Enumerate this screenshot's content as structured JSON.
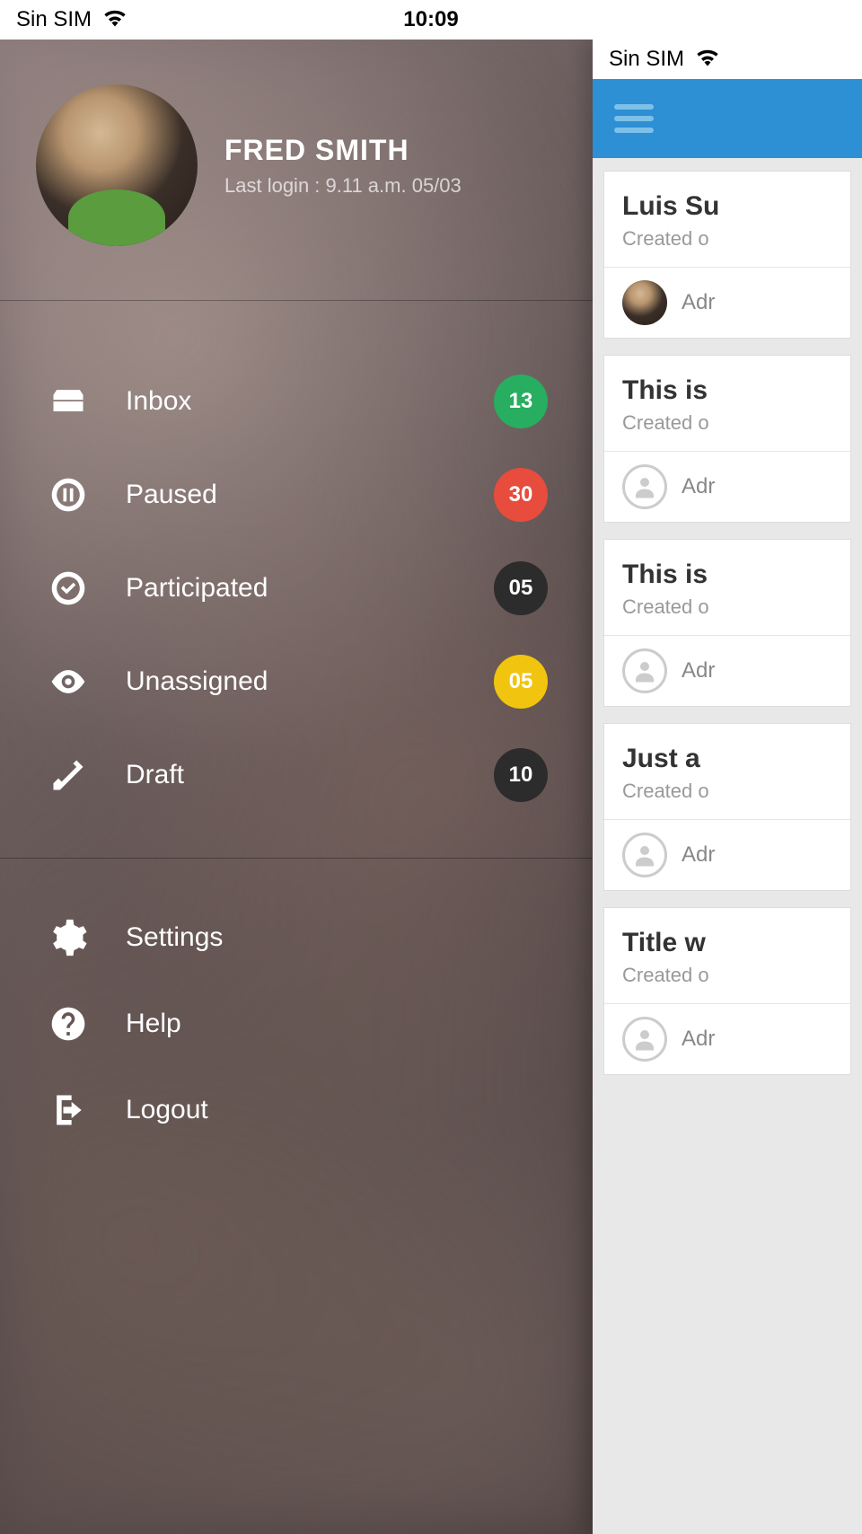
{
  "status_bar": {
    "carrier": "Sin SIM",
    "time": "10:09"
  },
  "profile": {
    "name": "FRED SMITH",
    "last_login": "Last login : 9.11 a.m. 05/03"
  },
  "menu": {
    "items": [
      {
        "label": "Inbox",
        "count": "13",
        "badge_class": "badge-green",
        "icon": "inbox"
      },
      {
        "label": "Paused",
        "count": "30",
        "badge_class": "badge-red",
        "icon": "pause"
      },
      {
        "label": "Participated",
        "count": "05",
        "badge_class": "badge-dark",
        "icon": "check"
      },
      {
        "label": "Unassigned",
        "count": "05",
        "badge_class": "badge-yellow",
        "icon": "eye"
      },
      {
        "label": "Draft",
        "count": "10",
        "badge_class": "badge-dark",
        "icon": "pencil"
      }
    ]
  },
  "bottom_menu": {
    "items": [
      {
        "label": "Settings",
        "icon": "gear"
      },
      {
        "label": "Help",
        "icon": "help"
      },
      {
        "label": "Logout",
        "icon": "logout"
      }
    ]
  },
  "content_status": {
    "carrier": "Sin SIM"
  },
  "list": {
    "cards": [
      {
        "title": "Luis Su",
        "subtitle": "Created o",
        "author": "Adr",
        "avatar": "photo"
      },
      {
        "title": "This is",
        "subtitle": "Created o",
        "author": "Adr",
        "avatar": "placeholder"
      },
      {
        "title": "This is",
        "subtitle": "Created o",
        "author": "Adr",
        "avatar": "placeholder"
      },
      {
        "title": "Just a",
        "subtitle": "Created o",
        "author": "Adr",
        "avatar": "placeholder"
      },
      {
        "title": "Title w",
        "subtitle": "Created o",
        "author": "Adr",
        "avatar": "placeholder"
      }
    ]
  }
}
